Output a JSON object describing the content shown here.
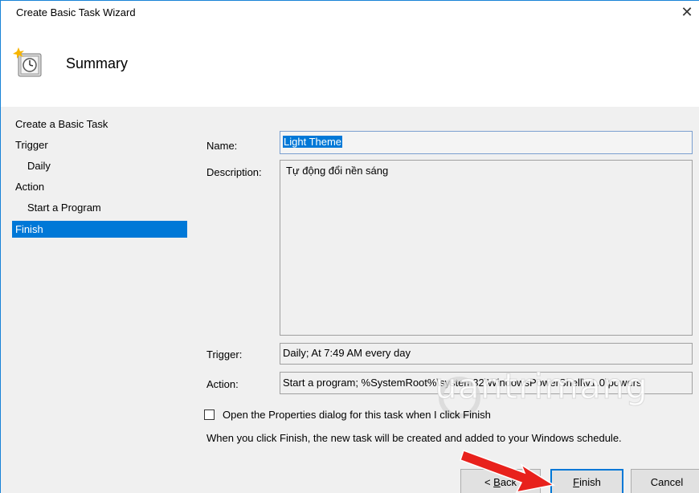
{
  "window": {
    "title": "Create Basic Task Wizard",
    "close_glyph": "✕"
  },
  "header": {
    "title": "Summary",
    "icon": "task-clock-icon"
  },
  "sidebar": {
    "items": [
      {
        "label": "Create a Basic Task"
      },
      {
        "label": "Trigger"
      },
      {
        "label": "Daily"
      },
      {
        "label": "Action"
      },
      {
        "label": "Start a Program"
      },
      {
        "label": "Finish"
      }
    ],
    "selected": "Finish"
  },
  "form": {
    "name_label": "Name:",
    "name_value": "Light Theme",
    "description_label": "Description:",
    "description_value": "Tự động đổi nền sáng",
    "trigger_label": "Trigger:",
    "trigger_value": "Daily; At 7:49 AM every day",
    "action_label": "Action:",
    "action_value": "Start a program; %SystemRoot%\\system32\\WindowsPowerShell\\v1.0\\powers"
  },
  "options": {
    "open_properties_label": "Open the Properties dialog for this task when I click Finish",
    "open_properties_checked": false,
    "info_text": "When you click Finish, the new task will be created and added to your Windows schedule."
  },
  "buttons": {
    "back_prefix": "< ",
    "back_key": "B",
    "back_rest": "ack",
    "finish_key": "F",
    "finish_rest": "inish",
    "cancel": "Cancel"
  },
  "watermark": {
    "text": "uantrimang"
  },
  "colors": {
    "selection": "#0078d7",
    "arrow": "#e8211c"
  }
}
